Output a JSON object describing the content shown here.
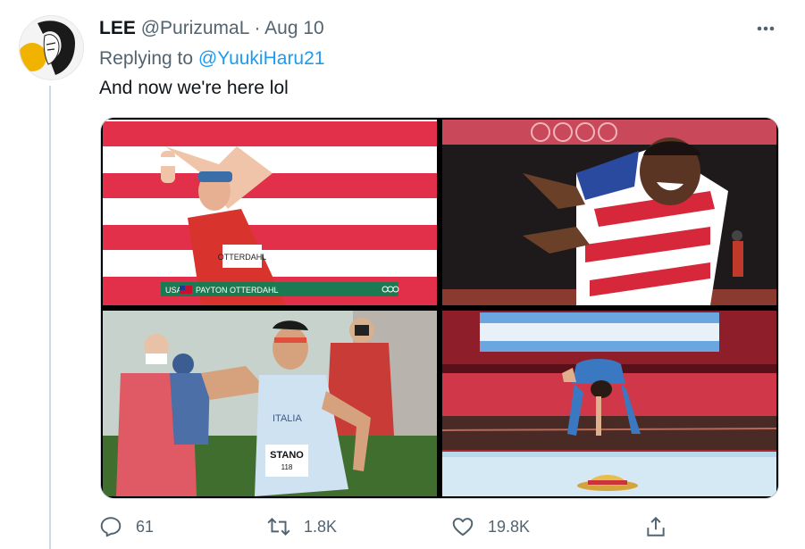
{
  "tweet": {
    "display_name": "LEE",
    "handle": "@PurizumaL",
    "separator": "·",
    "date": "Aug 10",
    "replying_prefix": "Replying to",
    "replying_to": "@YuukiHaru21",
    "text": "And now we're here lol"
  },
  "media": {
    "panel1": {
      "caption_country": "USA",
      "caption_name": "PAYTON OTTERDAHL",
      "bib": "OTTERDAHL"
    },
    "panel3": {
      "jersey": "ITALIA",
      "bib_name": "STANO",
      "bib_number": "118"
    }
  },
  "actions": {
    "reply_count": "61",
    "retweet_count": "1.8K",
    "like_count": "19.8K"
  },
  "icons": [
    "more-icon",
    "reply-icon",
    "retweet-icon",
    "like-icon",
    "share-icon"
  ],
  "colors": {
    "accent": "#1d9bf0",
    "muted": "#536471",
    "text": "#0f1419"
  }
}
